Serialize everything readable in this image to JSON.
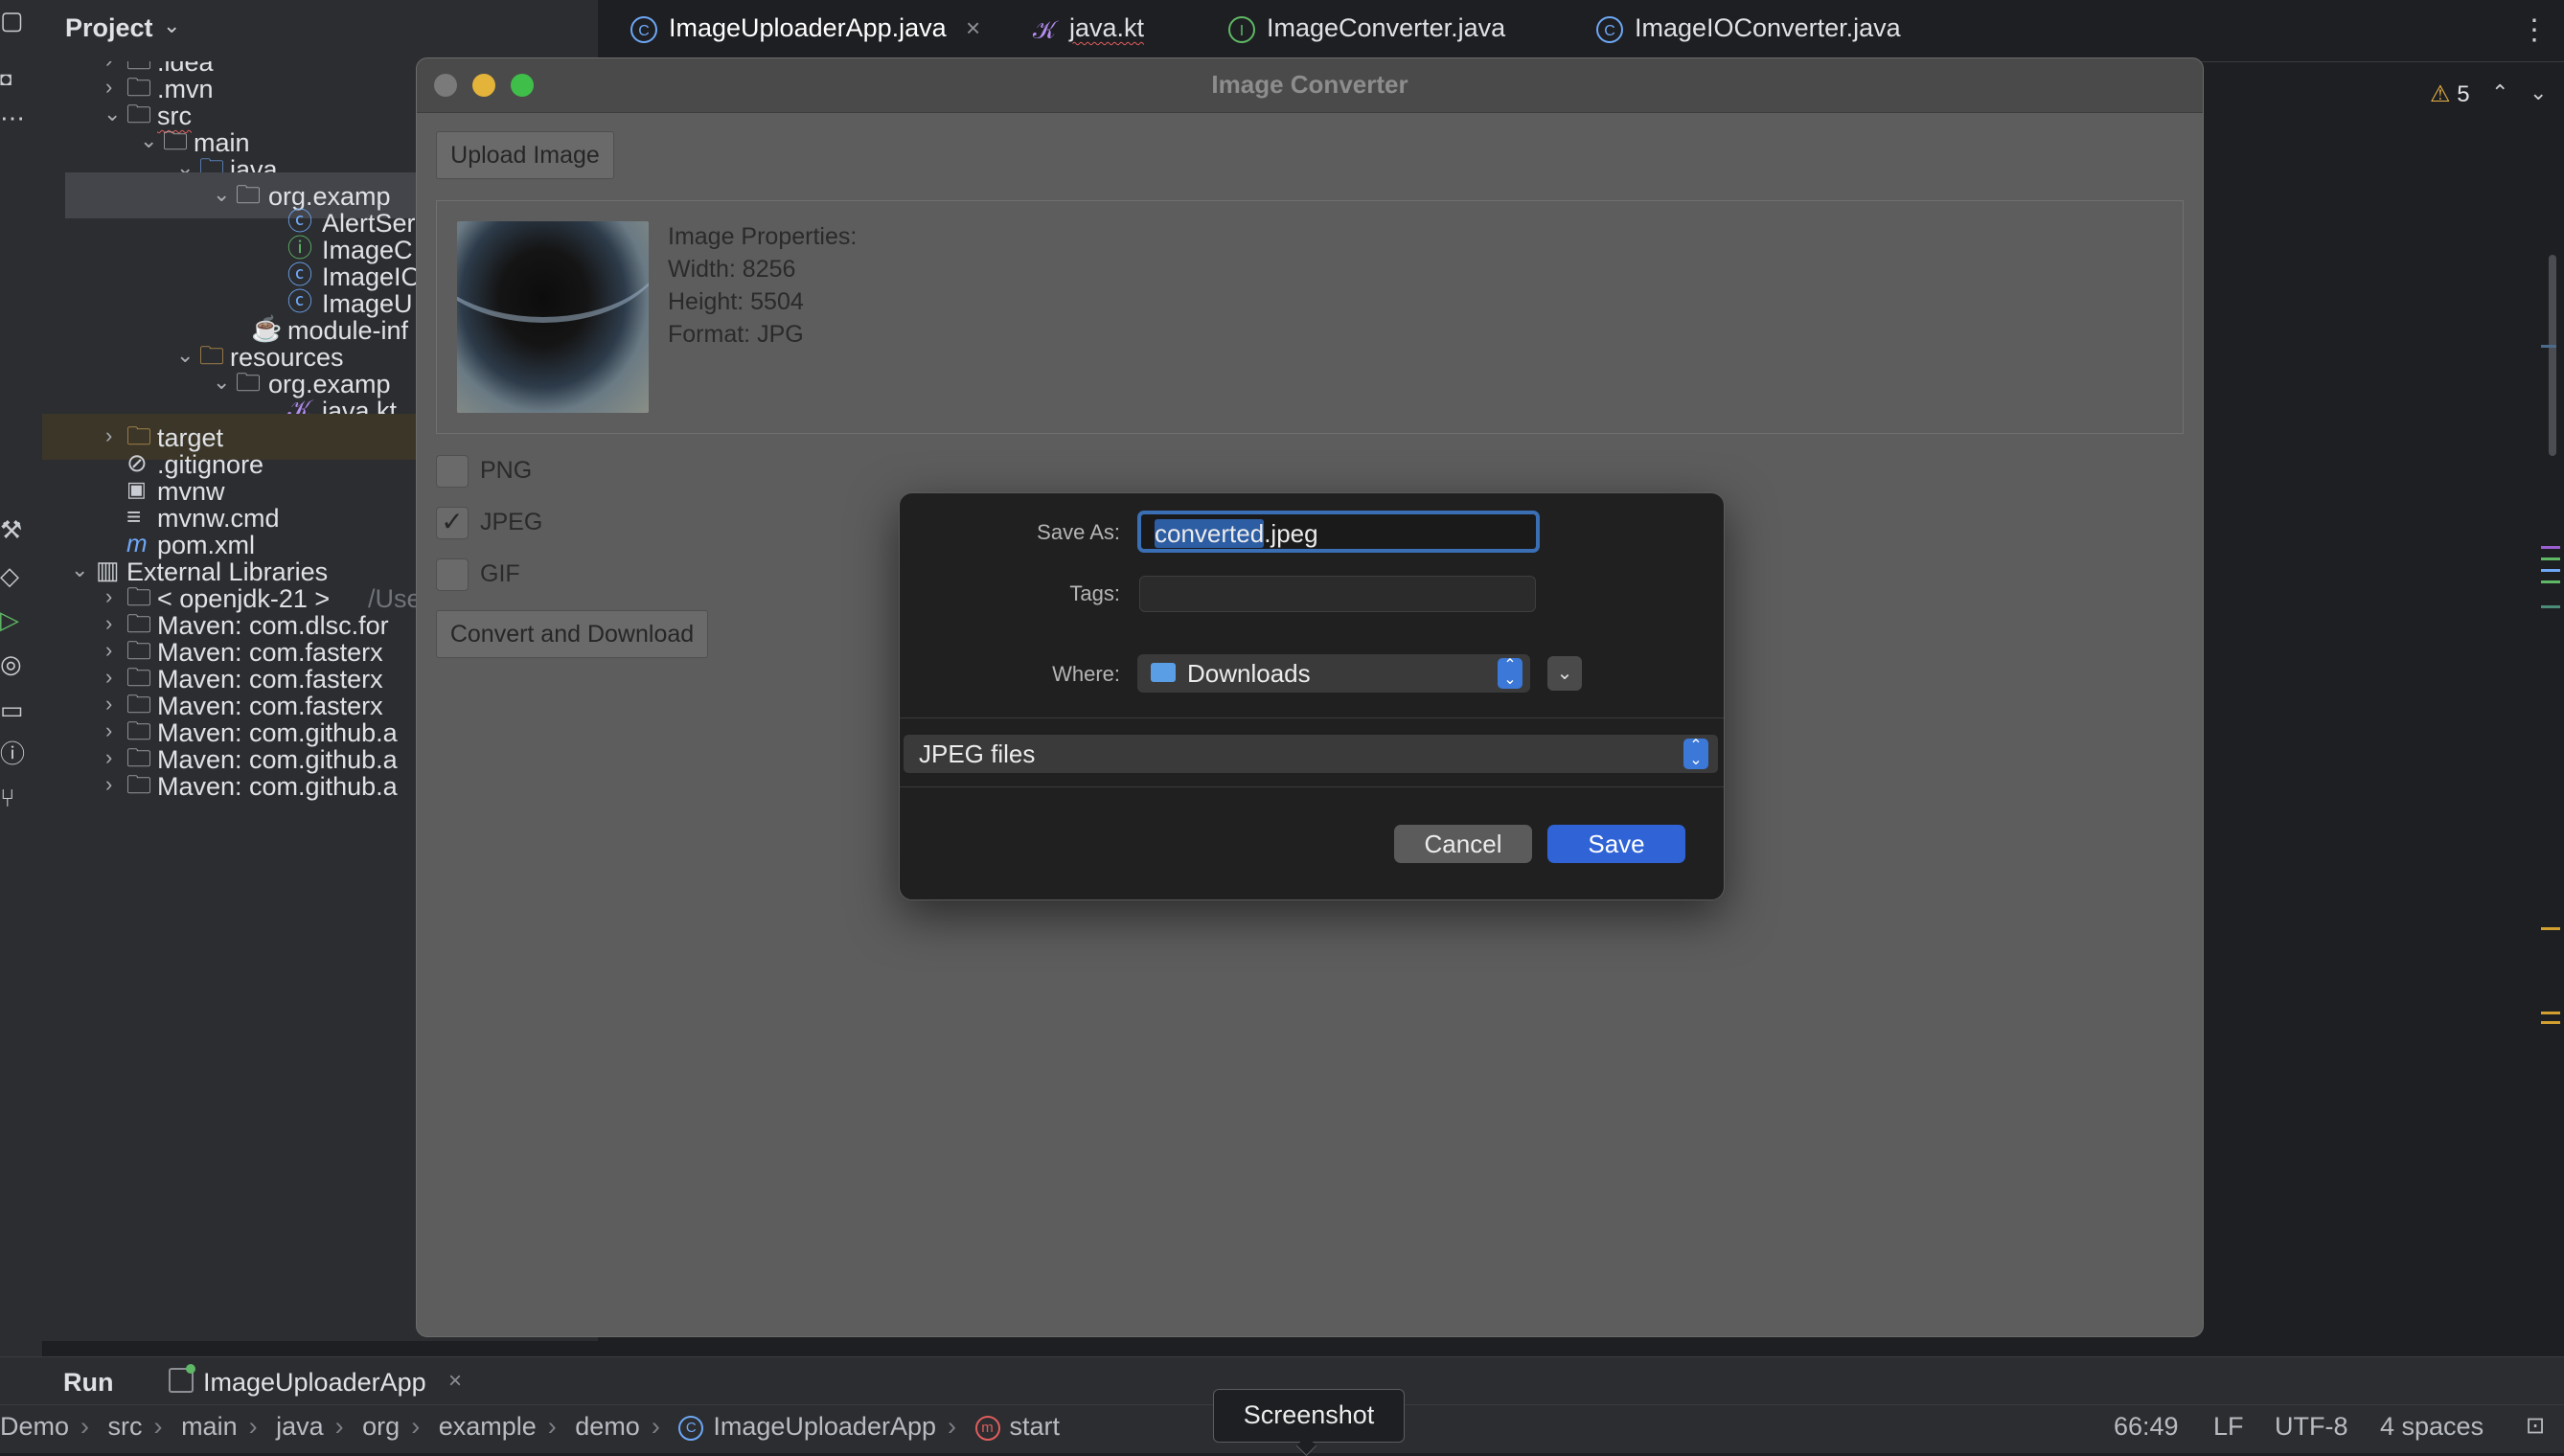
{
  "ide": {
    "project_label": "Project",
    "tabs": [
      {
        "label": "ImageUploaderApp.java",
        "icon": "class-icon"
      },
      {
        "label": "java.kt",
        "icon": "kotlin-icon"
      },
      {
        "label": "ImageConverter.java",
        "icon": "interface-icon"
      },
      {
        "label": "ImageIOConverter.java",
        "icon": "class-icon"
      }
    ],
    "tab_close": "×",
    "warnings": "5",
    "tree": [
      {
        "label": ".idea"
      },
      {
        "label": ".mvn"
      },
      {
        "label": "src"
      },
      {
        "label": "main"
      },
      {
        "label": "java"
      },
      {
        "label": "org.examp"
      },
      {
        "label": "AlertSer"
      },
      {
        "label": "ImageC"
      },
      {
        "label": "ImageIO"
      },
      {
        "label": "ImageU"
      },
      {
        "label": "module-inf"
      },
      {
        "label": "resources"
      },
      {
        "label": "org.examp"
      },
      {
        "label": "java.kt"
      },
      {
        "label": "target"
      },
      {
        "label": ".gitignore"
      },
      {
        "label": "mvnw"
      },
      {
        "label": "mvnw.cmd"
      },
      {
        "label": "pom.xml"
      },
      {
        "label": "External Libraries"
      },
      {
        "label": "< openjdk-21 >",
        "suffix": "/Use"
      },
      {
        "label": "Maven: com.dlsc.for"
      },
      {
        "label": "Maven: com.fasterx"
      },
      {
        "label": "Maven: com.fasterx"
      },
      {
        "label": "Maven: com.fasterx"
      },
      {
        "label": "Maven: com.github.a"
      },
      {
        "label": "Maven: com.github.a"
      },
      {
        "label": "Maven: com.github.a"
      }
    ],
    "run_label": "Run",
    "run_config": "ImageUploaderApp",
    "breadcrumbs": [
      "Demo",
      "src",
      "main",
      "java",
      "org",
      "example",
      "demo",
      "ImageUploaderApp",
      "start"
    ],
    "status": {
      "position": "66:49",
      "line_sep": "LF",
      "encoding": "UTF-8",
      "indent": "4 spaces"
    },
    "tooltip": "Screenshot"
  },
  "app": {
    "title": "Image Converter",
    "upload_button": "Upload Image",
    "properties": {
      "heading": "Image Properties:",
      "width": "Width: 8256",
      "height": "Height: 5504",
      "format": "Format: JPG"
    },
    "formats": [
      {
        "label": "PNG",
        "checked": false
      },
      {
        "label": "JPEG",
        "checked": true
      },
      {
        "label": "GIF",
        "checked": false
      }
    ],
    "convert_button": "Convert and Download"
  },
  "save_dialog": {
    "save_as_label": "Save As:",
    "filename_selected": "converted",
    "filename_ext": ".jpeg",
    "tags_label": "Tags:",
    "where_label": "Where:",
    "where_value": "Downloads",
    "file_type": "JPEG files",
    "cancel": "Cancel",
    "save": "Save"
  },
  "colors": {
    "accent_blue": "#2f63d6",
    "ide_bg": "#1e1f22",
    "panel_bg": "#2b2d30",
    "app_bg": "#5d5d5d"
  }
}
